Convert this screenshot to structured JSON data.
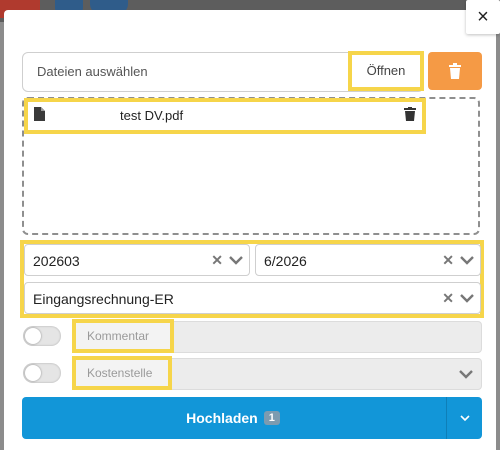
{
  "file_input": {
    "placeholder": "Dateien auswählen",
    "open_label": "Öffnen"
  },
  "files": [
    {
      "name": "test DV.pdf"
    }
  ],
  "fields": {
    "period": "202603",
    "month": "6/2026",
    "document_type": "Eingangsrechnung-ER",
    "comment_placeholder": "Kommentar",
    "cost_center_placeholder": "Kostenstelle"
  },
  "upload": {
    "label": "Hochladen",
    "count": "1"
  },
  "icons": {
    "close": "close-icon",
    "trash": "trash-icon",
    "file": "file-icon",
    "clear": "x-icon",
    "chevron": "chevron-down-icon"
  },
  "colors": {
    "primary": "#1296d8",
    "danger": "#f59a45",
    "highlight": "#f6d54a"
  }
}
